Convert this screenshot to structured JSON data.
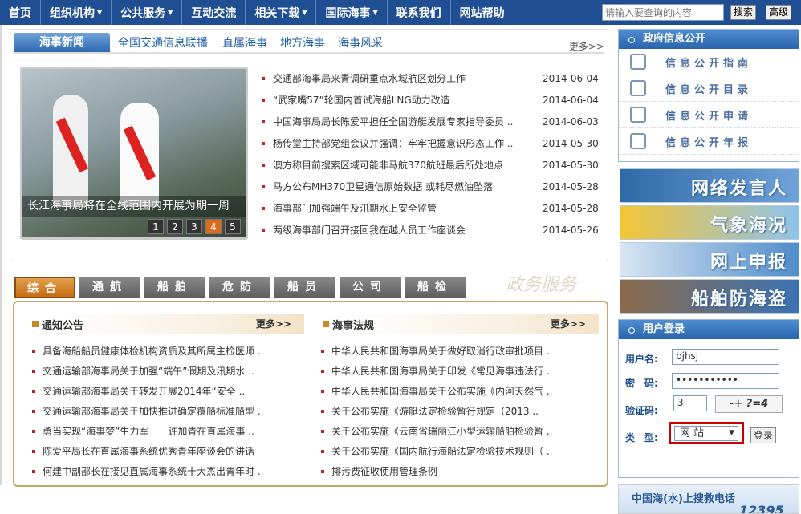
{
  "nav": {
    "items": [
      {
        "label": "首页",
        "dropdown": false
      },
      {
        "label": "组织机构",
        "dropdown": true
      },
      {
        "label": "公共服务",
        "dropdown": true
      },
      {
        "label": "互动交流",
        "dropdown": false
      },
      {
        "label": "相关下载",
        "dropdown": true
      },
      {
        "label": "国际海事",
        "dropdown": true
      },
      {
        "label": "联系我们",
        "dropdown": false
      },
      {
        "label": "网站帮助",
        "dropdown": false
      }
    ],
    "search_placeholder": "请输入要查询的内容",
    "search_button": "搜索",
    "advanced_button": "高级"
  },
  "news": {
    "tabs": [
      "海事新闻",
      "全国交通信息联播",
      "直属海事",
      "地方海事",
      "海事风采"
    ],
    "more": "更多>>",
    "slide_caption": "长江海事局将在全线范围内开展为期一周",
    "slide_numbers": [
      "1",
      "2",
      "3",
      "4",
      "5"
    ],
    "slide_active": "4",
    "items": [
      {
        "title": "交通部海事局来青调研重点水域航区划分工作",
        "date": "2014-06-04"
      },
      {
        "title": "“武家嘴57”轮国内首试海船LNG动力改造",
        "date": "2014-06-04"
      },
      {
        "title": "中国海事局局长陈爱平担任全国游艇发展专家指导委员 ..",
        "date": "2014-06-03"
      },
      {
        "title": "杨传堂主持部党组会议并强调：牢牢把握意识形态工作 ..",
        "date": "2014-05-30"
      },
      {
        "title": "澳方称目前搜索区域可能非马航370航班最后所处地点",
        "date": "2014-05-30"
      },
      {
        "title": "马方公布MH370卫星通信原始数据 或耗尽燃油坠落",
        "date": "2014-05-28"
      },
      {
        "title": "海事部门加强端午及汛期水上安全监管",
        "date": "2014-05-28"
      },
      {
        "title": "两级海事部门召开接回我在越人员工作座谈会",
        "date": "2014-05-26"
      }
    ]
  },
  "services": {
    "tabs": [
      "综合",
      "通航",
      "船舶",
      "危防",
      "船员",
      "公司",
      "船检"
    ],
    "active": "综合",
    "brand": "政务服务"
  },
  "notices": {
    "title": "通知公告",
    "more": "更多>>",
    "items": [
      "具备海船船员健康体检机构资质及其所属主检医师 ..",
      "交通运输部海事局关于加强“端午”假期及汛期水 ..",
      "交通运输部海事局关于转发开展2014年“安全 ..",
      "交通运输部海事局关于加快推进确定覆船标准船型 ..",
      "勇当实现“海事梦”生力军－－许加青在直属海事 ..",
      "陈爱平局长在直属海事系统优秀青年座谈会的讲话",
      "何建中副部长在接见直属海事系统十大杰出青年时 .."
    ]
  },
  "laws": {
    "title": "海事法规",
    "more": "更多>>",
    "items": [
      "中华人民共和国海事局关于做好取消行政审批项目 ..",
      "中华人民共和国海事局关于印发《常见海事违法行 ..",
      "中华人民共和国海事局关于公布实施《内河天然气 ..",
      "关于公布实施《游艇法定检验暂行规定（2013 ..",
      "关于公布实施《云南省瑞丽江小型运输船舶检验暂 ..",
      "关于公布实施《国内航行海船法定检验技术规则（ ..",
      "排污费征收使用管理条例"
    ]
  },
  "gov": {
    "title": "政府信息公开",
    "items": [
      "信息公开指南",
      "信息公开目录",
      "信息公开申请",
      "信息公开年报"
    ]
  },
  "banners": [
    "网络发言人",
    "气象海况",
    "网上申报",
    "船舶防海盗"
  ],
  "login": {
    "title": "用户登录",
    "user_label": "用户名:",
    "user_value": "bjhsj",
    "pwd_label": "密　码:",
    "pwd_value": "•••••••••••",
    "code_label": "验证码:",
    "code_value": "3",
    "captcha": "-+ ?=4",
    "type_label": "类　型:",
    "type_value": "网 站",
    "submit": "登录"
  },
  "rescue": {
    "title": "中国海(水)上搜救电话",
    "number": "12395"
  }
}
